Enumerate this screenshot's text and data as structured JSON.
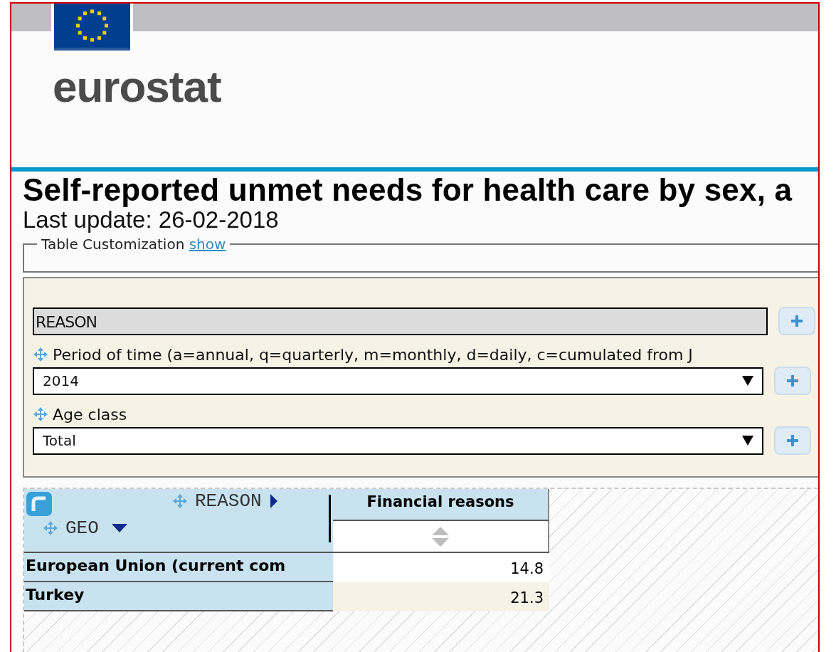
{
  "header": {
    "logo_text": "eurostat"
  },
  "title": "Self-reported unmet needs for health care by sex, a",
  "last_update": "Last update: 26-02-2018",
  "customization": {
    "legend": "Table Customization",
    "toggle_link": "show"
  },
  "filters": [
    {
      "kind": "pinned",
      "value": "REASON"
    },
    {
      "kind": "select",
      "label": "Period of time (a=annual, q=quarterly, m=monthly, d=daily, c=cumulated from J",
      "value": "2014"
    },
    {
      "kind": "select",
      "label": "Age class",
      "value": "Total"
    }
  ],
  "table": {
    "column_dimension": "REASON",
    "row_dimension": "GEO",
    "columns": [
      "Financial reasons"
    ],
    "rows": [
      {
        "label": "European Union (current com",
        "values": [
          "14.8"
        ]
      },
      {
        "label": "Turkey",
        "values": [
          "21.3"
        ]
      }
    ]
  }
}
